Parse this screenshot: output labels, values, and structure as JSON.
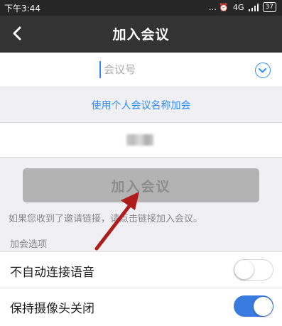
{
  "status_bar": {
    "time": "下午3:44",
    "network": "4G",
    "battery": "37",
    "extra_icons": "… ⏰"
  },
  "header": {
    "title": "加入会议"
  },
  "meeting_id": {
    "value": "",
    "placeholder": "会议号"
  },
  "personal_link_label": "使用个人会议名称加会",
  "name_field": {
    "value": "(blurred)"
  },
  "join_button_label": "加入会议",
  "hint_text": "如果您收到了邀请链接，请点击链接加入会议。",
  "options_section_label": "加会选项",
  "options": [
    {
      "label": "不自动连接语音",
      "enabled": false
    },
    {
      "label": "保持摄像头关闭",
      "enabled": true
    }
  ],
  "colors": {
    "accent": "#2d8cff",
    "header_bg": "#333333",
    "toggle_on": "#3a7be0",
    "annotation_arrow": "#b01c1c"
  }
}
